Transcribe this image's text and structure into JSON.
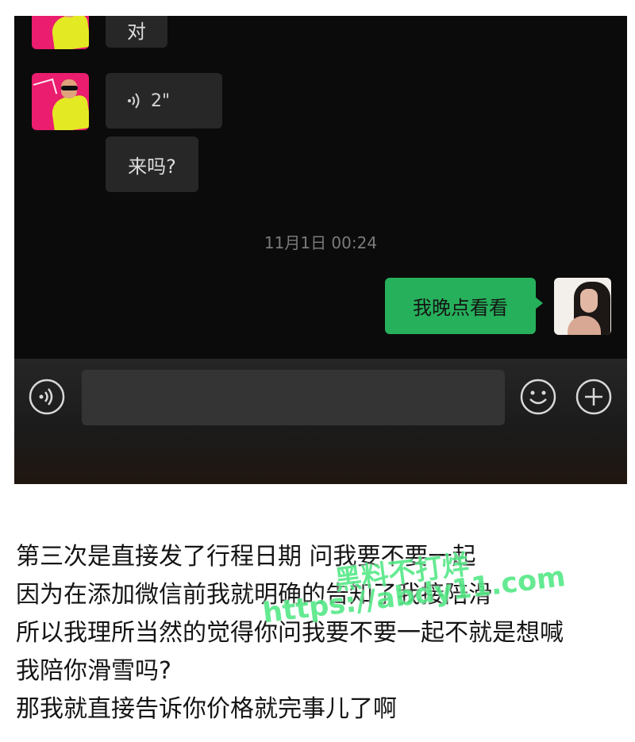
{
  "messages": [
    {
      "id": "m1",
      "direction": "received",
      "text": "对"
    },
    {
      "id": "m2",
      "direction": "received",
      "kind": "voice",
      "duration": "2\""
    },
    {
      "id": "m3",
      "direction": "received",
      "text": "来吗?"
    },
    {
      "id": "m4",
      "direction": "sent",
      "text": "我晚点看看"
    }
  ],
  "timestamp": "11月1日 00:24",
  "input_bar": {
    "voice_button_icon": "voice-input-icon",
    "emoji_button_icon": "emoji-icon",
    "more_button_icon": "plus-icon"
  },
  "caption": [
    "第三次是直接发了行程日期 问我要不要一起",
    "因为在添加微信前我就明确的告知了我接陪滑",
    "所以我理所当然的觉得你问我要不要一起不就是想喊",
    "我陪你滑雪吗?",
    "那我就直接告诉你价格就完事儿了啊"
  ],
  "watermark": {
    "line1": "黑料不打烊",
    "line2": "https://abdy11.com"
  },
  "colors": {
    "chat_background": "#0b0b0b",
    "received_bubble": "#272727",
    "sent_bubble": "#26b05b",
    "watermark": "#55e887"
  }
}
